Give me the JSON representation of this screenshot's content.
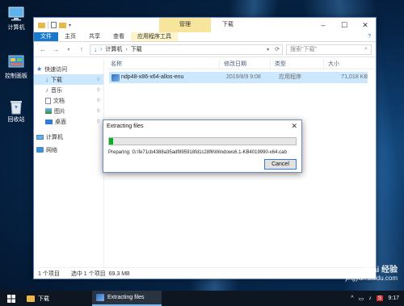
{
  "desktop": {
    "icons": [
      {
        "label": "计算机",
        "icon": "computer-icon"
      },
      {
        "label": "控制面板",
        "icon": "control-panel-icon"
      },
      {
        "label": "回收站",
        "icon": "recycle-bin-icon"
      }
    ]
  },
  "explorer": {
    "title": "下载",
    "context_tab": "管理",
    "ribbon_tabs": [
      "文件",
      "主页",
      "共享",
      "查看",
      "应用程序工具"
    ],
    "address": {
      "root": "计算机",
      "folder": "下载"
    },
    "search_placeholder": "搜索\"下载\"",
    "nav": {
      "quick_access": "快速访问",
      "items": [
        {
          "label": "下载",
          "icon": "download-folder-icon",
          "pinned": true
        },
        {
          "label": "音乐",
          "icon": "music-folder-icon",
          "pinned": true
        },
        {
          "label": "文档",
          "icon": "document-folder-icon",
          "pinned": true
        },
        {
          "label": "图片",
          "icon": "picture-folder-icon",
          "pinned": true
        },
        {
          "label": "桌面",
          "icon": "desktop-folder-icon",
          "pinned": true
        }
      ],
      "computer": "计算机",
      "network": "网络"
    },
    "columns": [
      "名称",
      "修改日期",
      "类型",
      "大小"
    ],
    "files": [
      {
        "name": "ndp48-x86-x64-allos-enu",
        "modified": "2019/8/9 9:08",
        "type": "应用程序",
        "size": "71,018 KB"
      }
    ],
    "status": {
      "count": "1 个项目",
      "selected": "选中 1 个项目",
      "size": "69.3 MB"
    }
  },
  "dialog": {
    "title": "Extracting files",
    "progress": 0.02,
    "preparing": "Preparing: G:\\fe71cb4388a35adf895918fd1c28f6\\Windows6.1-KB4019990-x64.cab",
    "cancel_label": "Cancel"
  },
  "taskbar": {
    "items": [
      {
        "label": "下载",
        "icon": "folder-icon"
      },
      {
        "label": "Extracting files",
        "icon": "installer-icon"
      }
    ],
    "time": "9:17"
  },
  "watermark": {
    "line1": "Bai 经验",
    "line2": "jingyan.baidu.com"
  },
  "colors": {
    "accent": "#1979ca",
    "progress": "#06b025",
    "selection": "#cce8ff",
    "context_tab": "#f6e59a"
  }
}
